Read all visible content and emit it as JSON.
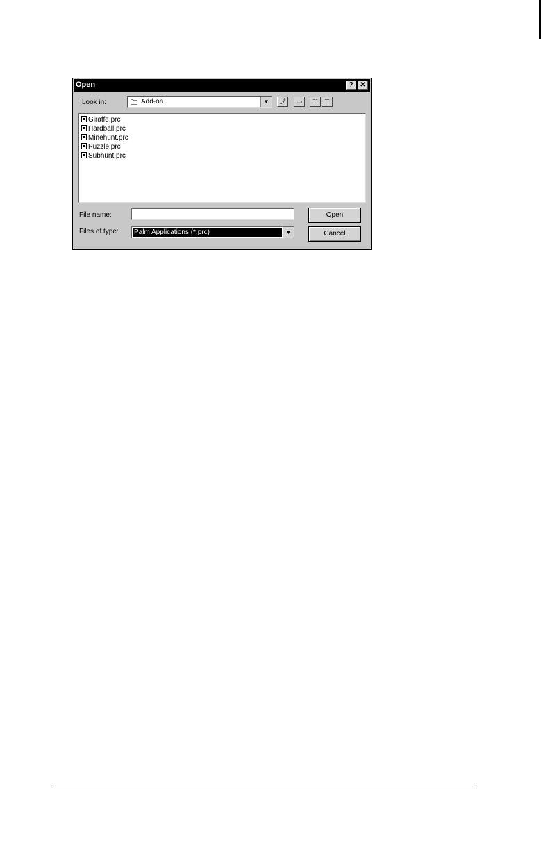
{
  "dialog": {
    "title": "Open",
    "help_button": "?",
    "close_button": "✕"
  },
  "look_in": {
    "label": "Look in:",
    "value": "Add-on",
    "folder_icon": "folder-icon"
  },
  "toolbar": {
    "up_folder_icon": "up-folder-icon",
    "new_folder_icon": "new-folder-icon",
    "list_view_icon": "list-view-icon",
    "details_view_icon": "details-view-icon"
  },
  "files": [
    "Giraffe.prc",
    "Hardball.prc",
    "Minehunt.prc",
    "Puzzle.prc",
    "Subhunt.prc"
  ],
  "file_name": {
    "label": "File name:",
    "value": ""
  },
  "files_of_type": {
    "label": "Files of type:",
    "value": "Palm Applications (*.prc)"
  },
  "buttons": {
    "open": "Open",
    "cancel": "Cancel"
  }
}
